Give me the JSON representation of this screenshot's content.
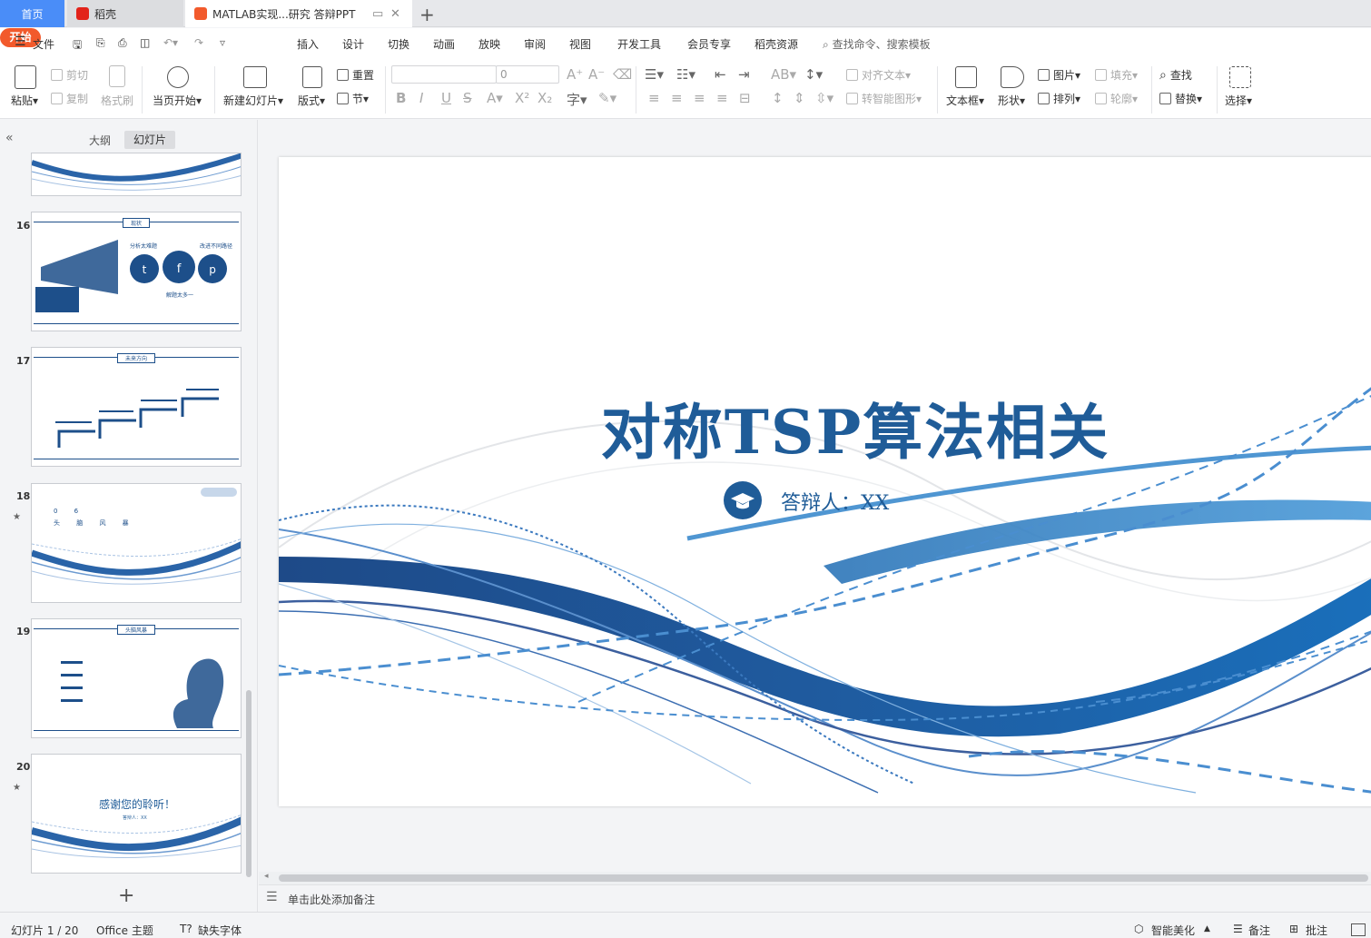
{
  "tabs": {
    "home": "首页",
    "docer": "稻壳",
    "document": "MATLAB实现...研究 答辩PPT"
  },
  "menu": {
    "file": "文件",
    "items": [
      "开始",
      "插入",
      "设计",
      "切换",
      "动画",
      "放映",
      "审阅",
      "视图",
      "开发工具",
      "会员专享",
      "稻壳资源"
    ],
    "search": "查找命令、搜索模板"
  },
  "ribbon": {
    "paste": "粘贴",
    "cut": "剪切",
    "copy": "复制",
    "format_painter": "格式刷",
    "start_from_current": "当页开始",
    "new_slide": "新建幻灯片",
    "layout": "版式",
    "reset": "重置",
    "section": "节",
    "font_size": "0",
    "align_text": "对齐文本",
    "smart_art": "转智能图形",
    "text_box": "文本框",
    "shape": "形状",
    "picture": "图片",
    "arrange": "排列",
    "fill": "填充",
    "outline": "轮廓",
    "find": "查找",
    "replace": "替换",
    "select": "选择"
  },
  "panel": {
    "outline": "大纲",
    "slides": "幻灯片",
    "thumbs": [
      {
        "num": "16",
        "title": "现状",
        "text_left": "分析太难题",
        "text_right": "改进不同路径",
        "text_bottom": "解题太多一"
      },
      {
        "num": "17",
        "title": "未来方向"
      },
      {
        "num": "18",
        "line1": "0 6",
        "line2": "头 脑 风 暴"
      },
      {
        "num": "19",
        "title": "头脑风暴"
      },
      {
        "num": "20",
        "title": "感谢您的聆听！",
        "speaker": "答辩人：XX"
      }
    ]
  },
  "slide": {
    "title": "对称TSP算法相关",
    "speaker": "答辩人：XX"
  },
  "notes_placeholder": "单击此处添加备注",
  "status": {
    "slide_counter": "幻灯片 1 / 20",
    "theme": "Office 主题",
    "missing_font": "缺失字体",
    "beautify": "智能美化",
    "notes": "备注",
    "comments": "批注"
  },
  "colors": {
    "accent": "#4a8df8",
    "start_tab": "#f25a2c",
    "slide_blue": "#1f5c98"
  }
}
